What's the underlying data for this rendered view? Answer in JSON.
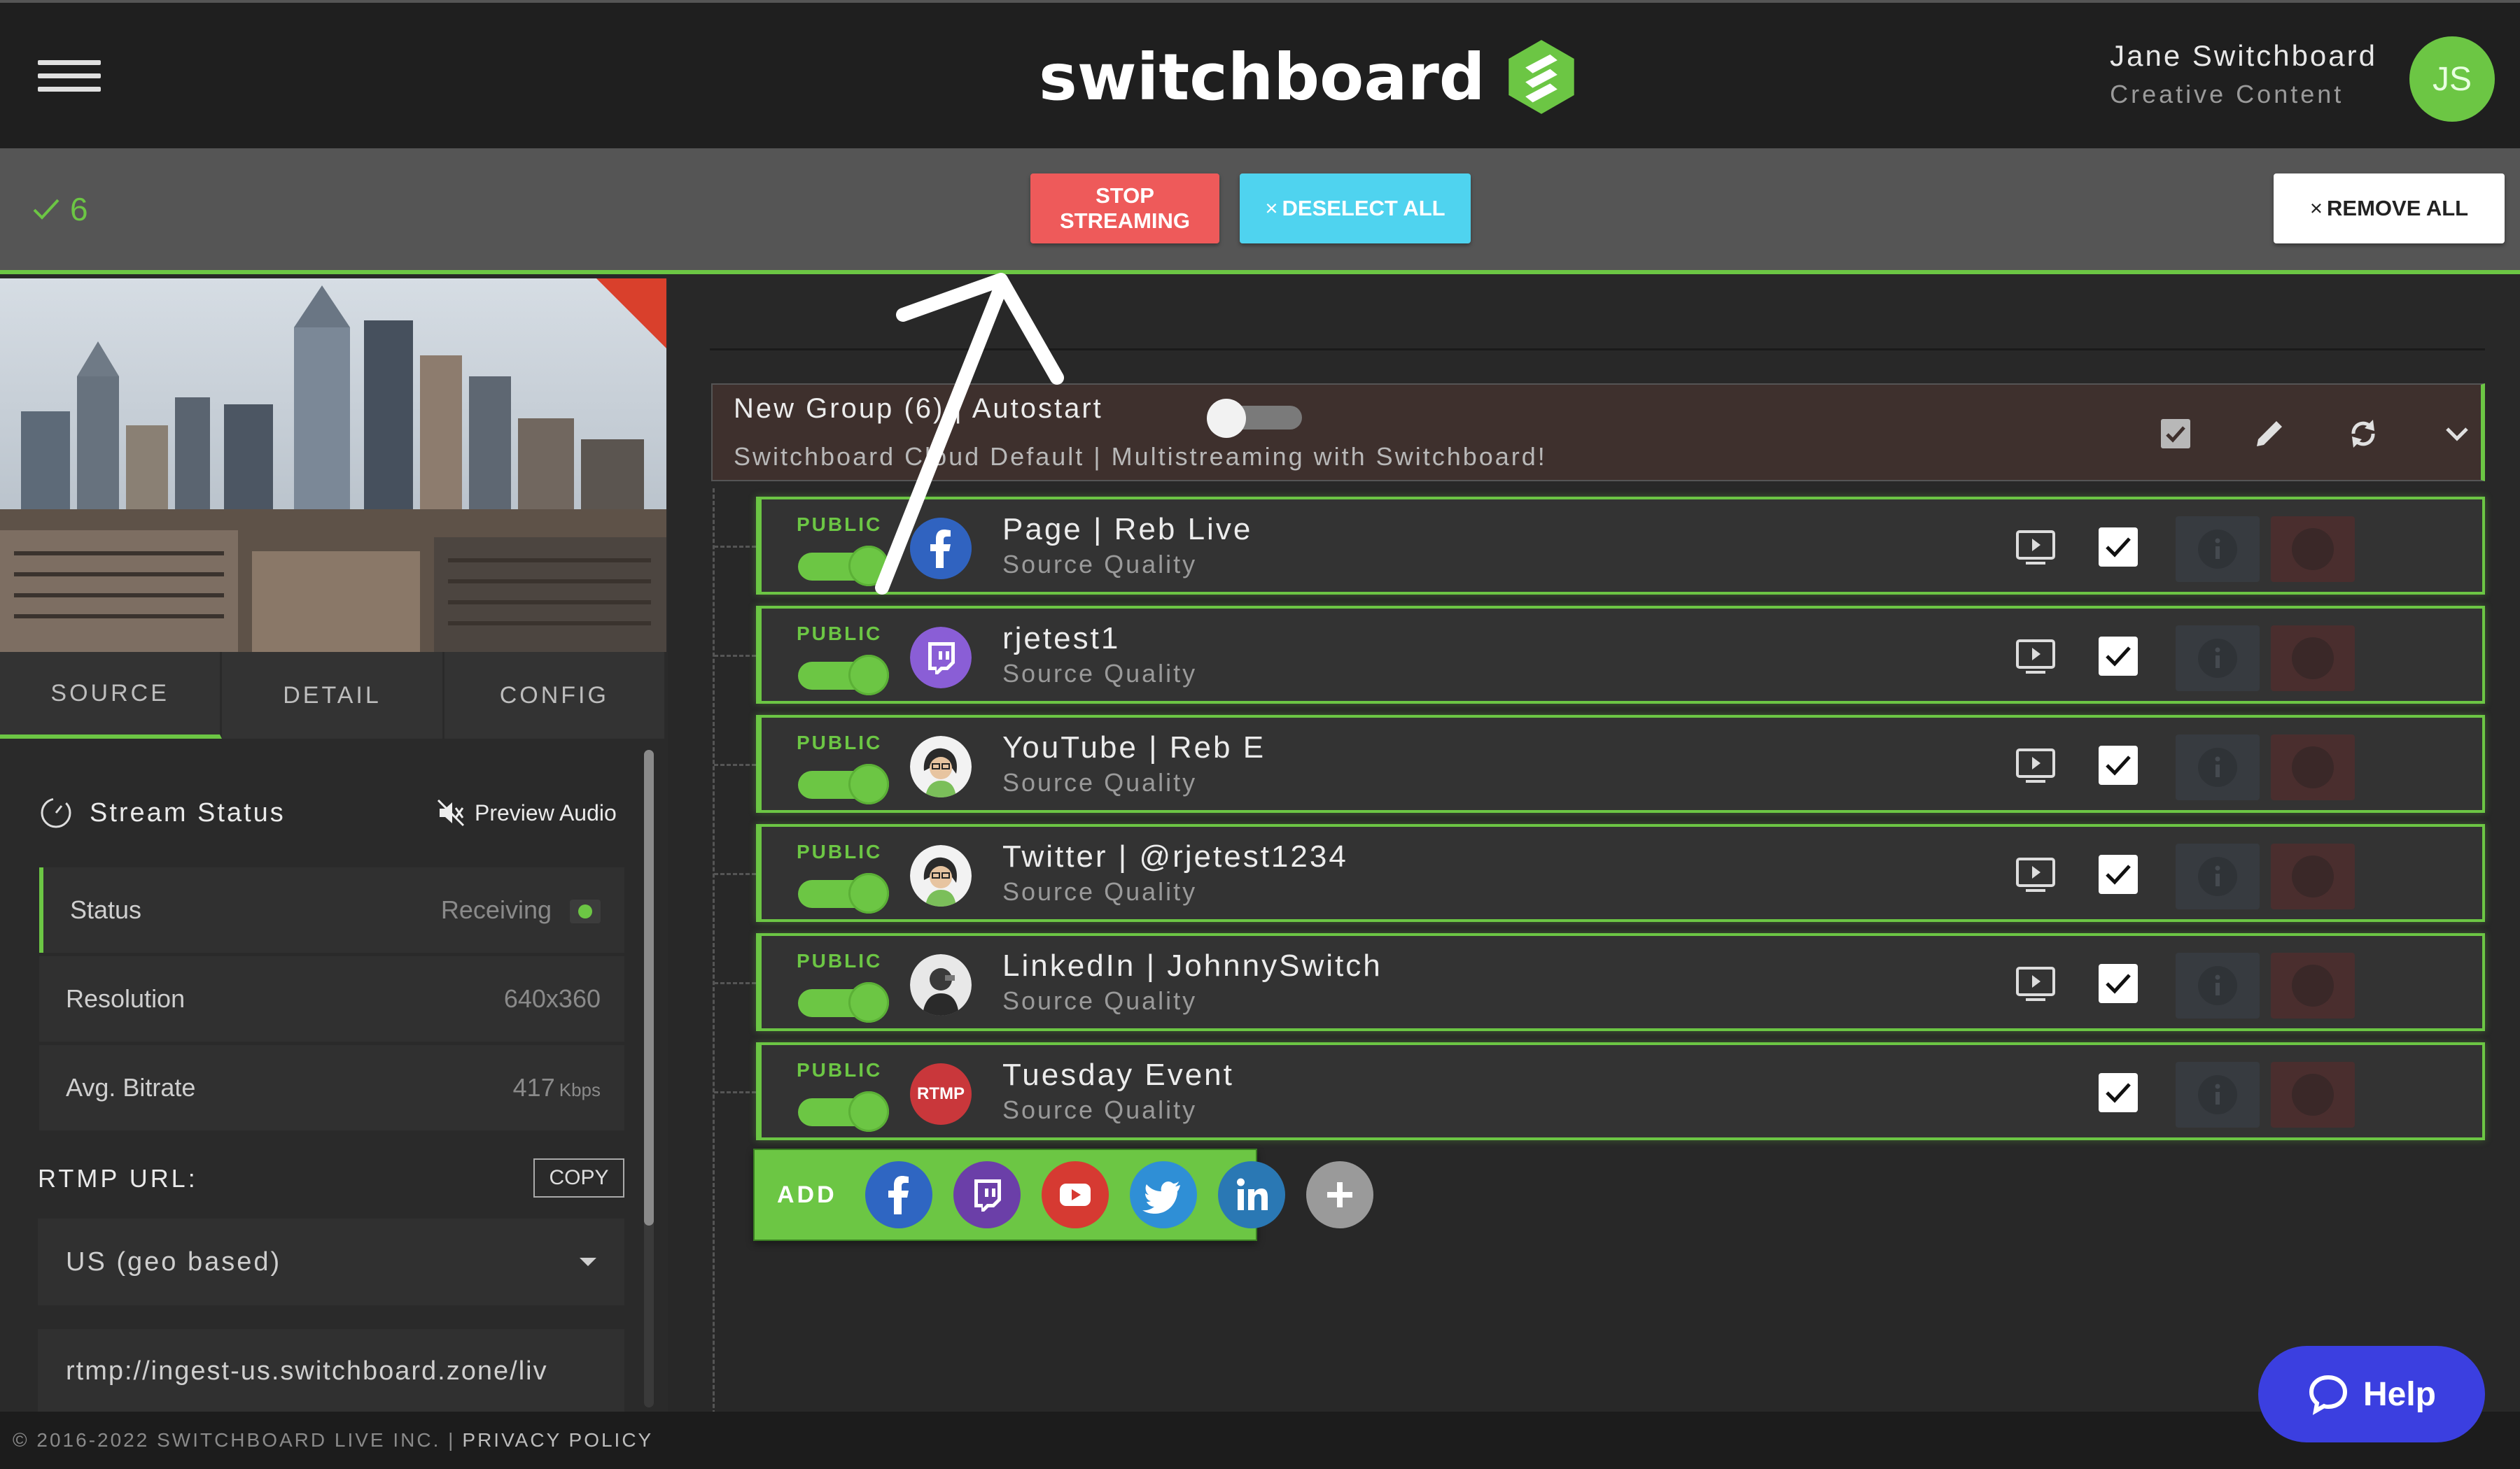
{
  "header": {
    "logo_text": "switchboard",
    "user_name": "Jane Switchboard",
    "user_role": "Creative Content",
    "avatar_initials": "JS"
  },
  "toolbar": {
    "selected_count": "6",
    "stop_line1": "STOP",
    "stop_line2": "STREAMING",
    "deselect_label": "DESELECT ALL",
    "remove_label": "REMOVE ALL"
  },
  "tabs": [
    {
      "label": "SOURCE",
      "active": true
    },
    {
      "label": "DETAIL",
      "active": false
    },
    {
      "label": "CONFIG",
      "active": false
    }
  ],
  "stream_status": {
    "title": "Stream Status",
    "preview_audio": "Preview Audio",
    "rows": [
      {
        "label": "Status",
        "value": "Receiving",
        "unit": ""
      },
      {
        "label": "Resolution",
        "value": "640x360",
        "unit": ""
      },
      {
        "label": "Avg. Bitrate",
        "value": "417",
        "unit": "Kbps"
      }
    ]
  },
  "rtmp": {
    "label": "RTMP URL:",
    "copy_label": "COPY",
    "region": "US (geo based)",
    "url": "rtmp://ingest-us.switchboard.zone/liv"
  },
  "group": {
    "title": "New Group (6) | Autostart",
    "subtitle": "Switchboard Cloud Default | Multistreaming with Switchboard!"
  },
  "destinations": [
    {
      "visibility": "PUBLIC",
      "name": "Page | Reb Live",
      "quality": "Source Quality",
      "icon": "facebook-icon",
      "has_preview": true
    },
    {
      "visibility": "PUBLIC",
      "name": "rjetest1",
      "quality": "Source Quality",
      "icon": "twitch-icon",
      "has_preview": true
    },
    {
      "visibility": "PUBLIC",
      "name": "YouTube | Reb E",
      "quality": "Source Quality",
      "icon": "youtube-avatar",
      "has_preview": true
    },
    {
      "visibility": "PUBLIC",
      "name": "Twitter | @rjetest1234",
      "quality": "Source Quality",
      "icon": "twitter-avatar",
      "has_preview": true
    },
    {
      "visibility": "PUBLIC",
      "name": "LinkedIn | JohnnySwitch",
      "quality": "Source Quality",
      "icon": "linkedin-avatar",
      "has_preview": true
    },
    {
      "visibility": "PUBLIC",
      "name": "Tuesday Event",
      "quality": "Source Quality",
      "icon": "rtmp-icon",
      "has_preview": false,
      "badge": "RTMP"
    }
  ],
  "add_bar": {
    "label": "ADD",
    "platforms": [
      "facebook-icon",
      "twitch-icon",
      "youtube-icon",
      "twitter-icon",
      "linkedin-icon",
      "plus-icon"
    ]
  },
  "footer": {
    "copyright": "© 2016-2022 SWITCHBOARD LIVE INC. |",
    "privacy": "PRIVACY POLICY"
  },
  "help": {
    "label": "Help"
  },
  "colors": {
    "accent_green": "#6cc644",
    "stop_red": "#ee5a5a",
    "deselect_blue": "#4fd3ef",
    "help_blue": "#3b3fe0"
  }
}
